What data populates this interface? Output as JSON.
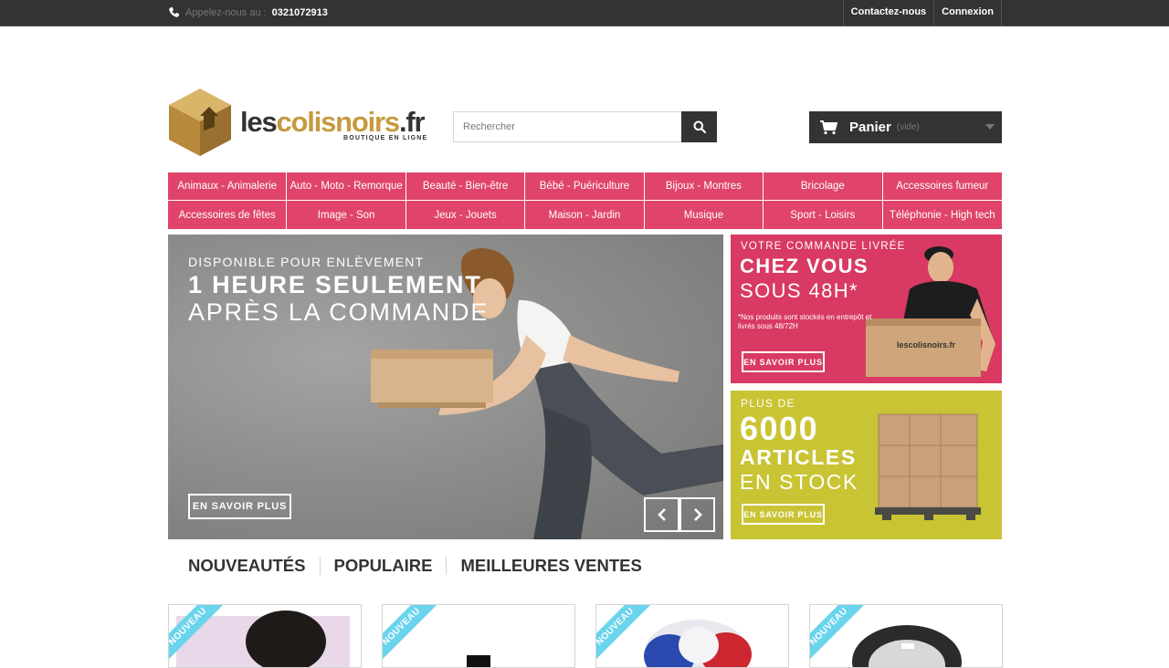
{
  "topbar": {
    "phone_label": "Appelez-nous au :",
    "phone_number": "0321072913",
    "contact_link": "Contactez-nous",
    "login_link": "Connexion"
  },
  "header": {
    "logo_prefix": "les",
    "logo_highlight": "colisnoirs",
    "logo_suffix": ".fr",
    "logo_tagline": "BOUTIQUE EN LIGNE",
    "search_placeholder": "Rechercher",
    "cart_label": "Panier",
    "cart_status": "(vide)"
  },
  "menu": {
    "items": [
      "Animaux - Animalerie",
      "Auto - Moto - Remorque",
      "Beauté - Bien-être",
      "Bébé - Puériculture",
      "Bijoux - Montres",
      "Bricolage",
      "Accessoires fumeur",
      "Accessoires de fêtes",
      "Image - Son",
      "Jeux - Jouets",
      "Maison - Jardin",
      "Musique",
      "Sport - Loisirs",
      "Téléphonie - High tech"
    ]
  },
  "slider": {
    "line1": "DISPONIBLE POUR ENLÈVEMENT",
    "line2": "1 HEURE SEULEMENT",
    "line3": "APRÈS LA COMMANDE",
    "button": "EN SAVOIR PLUS"
  },
  "promo1": {
    "line1": "VOTRE COMMANDE LIVRÉE",
    "line2": "CHEZ VOUS",
    "line3": "SOUS 48H*",
    "note": "*Nos produits sont stockés en entrepôt et livrés sous 48/72H",
    "box_label": "lescolisnoirs.fr",
    "button": "EN SAVOIR PLUS"
  },
  "promo2": {
    "line1": "PLUS DE",
    "line2": "6000",
    "line3": "ARTICLES",
    "line4": "EN STOCK",
    "button": "EN SAVOIR PLUS"
  },
  "tabs": [
    "NOUVEAUTÉS",
    "POPULAIRE",
    "MEILLEURES VENTES"
  ],
  "products": [
    {
      "badge": "NOUVEAU"
    },
    {
      "badge": "NOUVEAU"
    },
    {
      "badge": "NOUVEAU"
    },
    {
      "badge": "NOUVEAU"
    }
  ],
  "colors": {
    "menu_bg": "#e0446a",
    "promo1_bg": "#d83a63",
    "promo2_bg": "#c9c434",
    "dark": "#333333",
    "badge": "#6ad4ec",
    "logo_gold": "#c79a3f"
  },
  "icons": {
    "phone": "phone-icon",
    "search": "search-icon",
    "cart": "cart-icon",
    "prev": "chevron-left-icon",
    "next": "chevron-right-icon"
  }
}
